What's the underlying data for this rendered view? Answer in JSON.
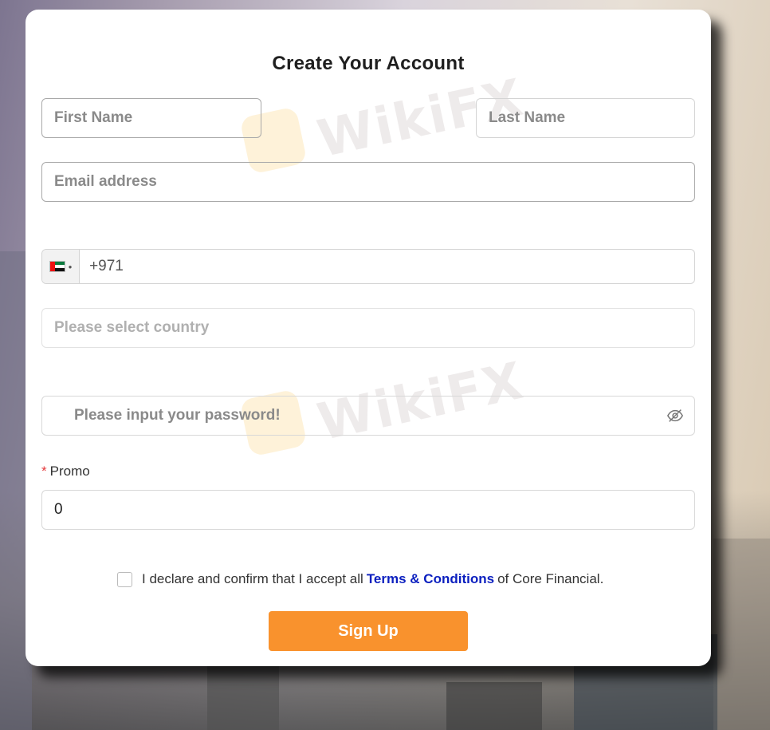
{
  "form": {
    "title": "Create Your Account",
    "first_name_placeholder": "First Name",
    "last_name_placeholder": "Last Name",
    "email_placeholder": "Email address",
    "phone": {
      "flag": "ae-flag-icon",
      "dial_code": "+971"
    },
    "country_placeholder": "Please select country",
    "password_placeholder": "Please input your password!",
    "promo": {
      "required_mark": "*",
      "label": "Promo",
      "value": "0"
    },
    "terms": {
      "text_before": "I declare and confirm that I accept all",
      "link_text": "Terms & Conditions",
      "text_after": "of Core Financial."
    },
    "submit_label": "Sign Up"
  },
  "watermark": {
    "text": "WikiFX"
  },
  "colors": {
    "accent": "#f9922d",
    "link": "#0b1fbf",
    "required": "#e4393c"
  }
}
